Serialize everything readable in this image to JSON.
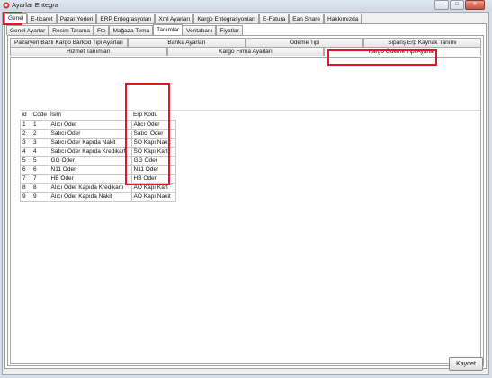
{
  "window": {
    "title": "Ayarlar Entegra",
    "buttons": [
      "—",
      "□",
      "✕"
    ]
  },
  "top_tabs": [
    {
      "label": "Genel",
      "active": true
    },
    {
      "label": "E-ticaret",
      "active": false
    },
    {
      "label": "Pazar Yerleri",
      "active": false
    },
    {
      "label": "ERP Entegrasyoları",
      "active": false
    },
    {
      "label": "Xml Ayarları",
      "active": false
    },
    {
      "label": "Kargo Entegrasyonları",
      "active": false
    },
    {
      "label": "E-Fatura",
      "active": false
    },
    {
      "label": "Ean Share",
      "active": false
    },
    {
      "label": "Hakkımızda",
      "active": false
    }
  ],
  "sub_tabs": [
    {
      "label": "Genel Ayarlar",
      "active": false
    },
    {
      "label": "Resim Tarama",
      "active": false
    },
    {
      "label": "Ftp",
      "active": false
    },
    {
      "label": "Mağaza Tema",
      "active": false
    },
    {
      "label": "Tanımlar",
      "active": true
    },
    {
      "label": "Veritabanı",
      "active": false
    },
    {
      "label": "Fiyatlar",
      "active": false
    }
  ],
  "def_tabs_row1": [
    {
      "label": "Pazaryeri Bazlı Kargo Barkod Tipi Ayarları"
    },
    {
      "label": "Banka Ayarları"
    },
    {
      "label": "Ödeme Tipi"
    },
    {
      "label": "Sipariş Erp Kaynak Tanımı"
    }
  ],
  "def_tabs_row2": [
    {
      "label": "Hizmet Tanımları",
      "active": false
    },
    {
      "label": "Kargo Firma Ayarları",
      "active": false
    },
    {
      "label": "Kargo Ödeme Tipi Ayarları",
      "active": true
    }
  ],
  "grid": {
    "columns": [
      "id",
      "Code",
      "İsim",
      "Erp Kodu"
    ],
    "rows": [
      [
        "1",
        "1",
        "Alıcı Öder",
        "Alıcı Öder"
      ],
      [
        "2",
        "2",
        "Satıcı Öder",
        "Satıcı Öder"
      ],
      [
        "3",
        "3",
        "Satıcı Öder Kapıda Nakit",
        "SÖ Kapı Nakit"
      ],
      [
        "4",
        "4",
        "Satıcı Öder Kapıda Kredikart",
        "SÖ Kapı Kart"
      ],
      [
        "5",
        "5",
        "GG Öder",
        "GG Öder"
      ],
      [
        "6",
        "6",
        "N11 Öder",
        "N11 Öder"
      ],
      [
        "7",
        "7",
        "HB Öder",
        "HB Öder"
      ],
      [
        "8",
        "8",
        "Alıcı Öder Kapıda Kredikartı",
        "AÖ Kapı Kart"
      ],
      [
        "9",
        "9",
        "Alıcı Öder Kapıda Nakit",
        "AÖ Kapı Nakit"
      ]
    ]
  },
  "footer": {
    "save_label": "Kaydet"
  },
  "colors": {
    "highlight": "#e8141f"
  }
}
